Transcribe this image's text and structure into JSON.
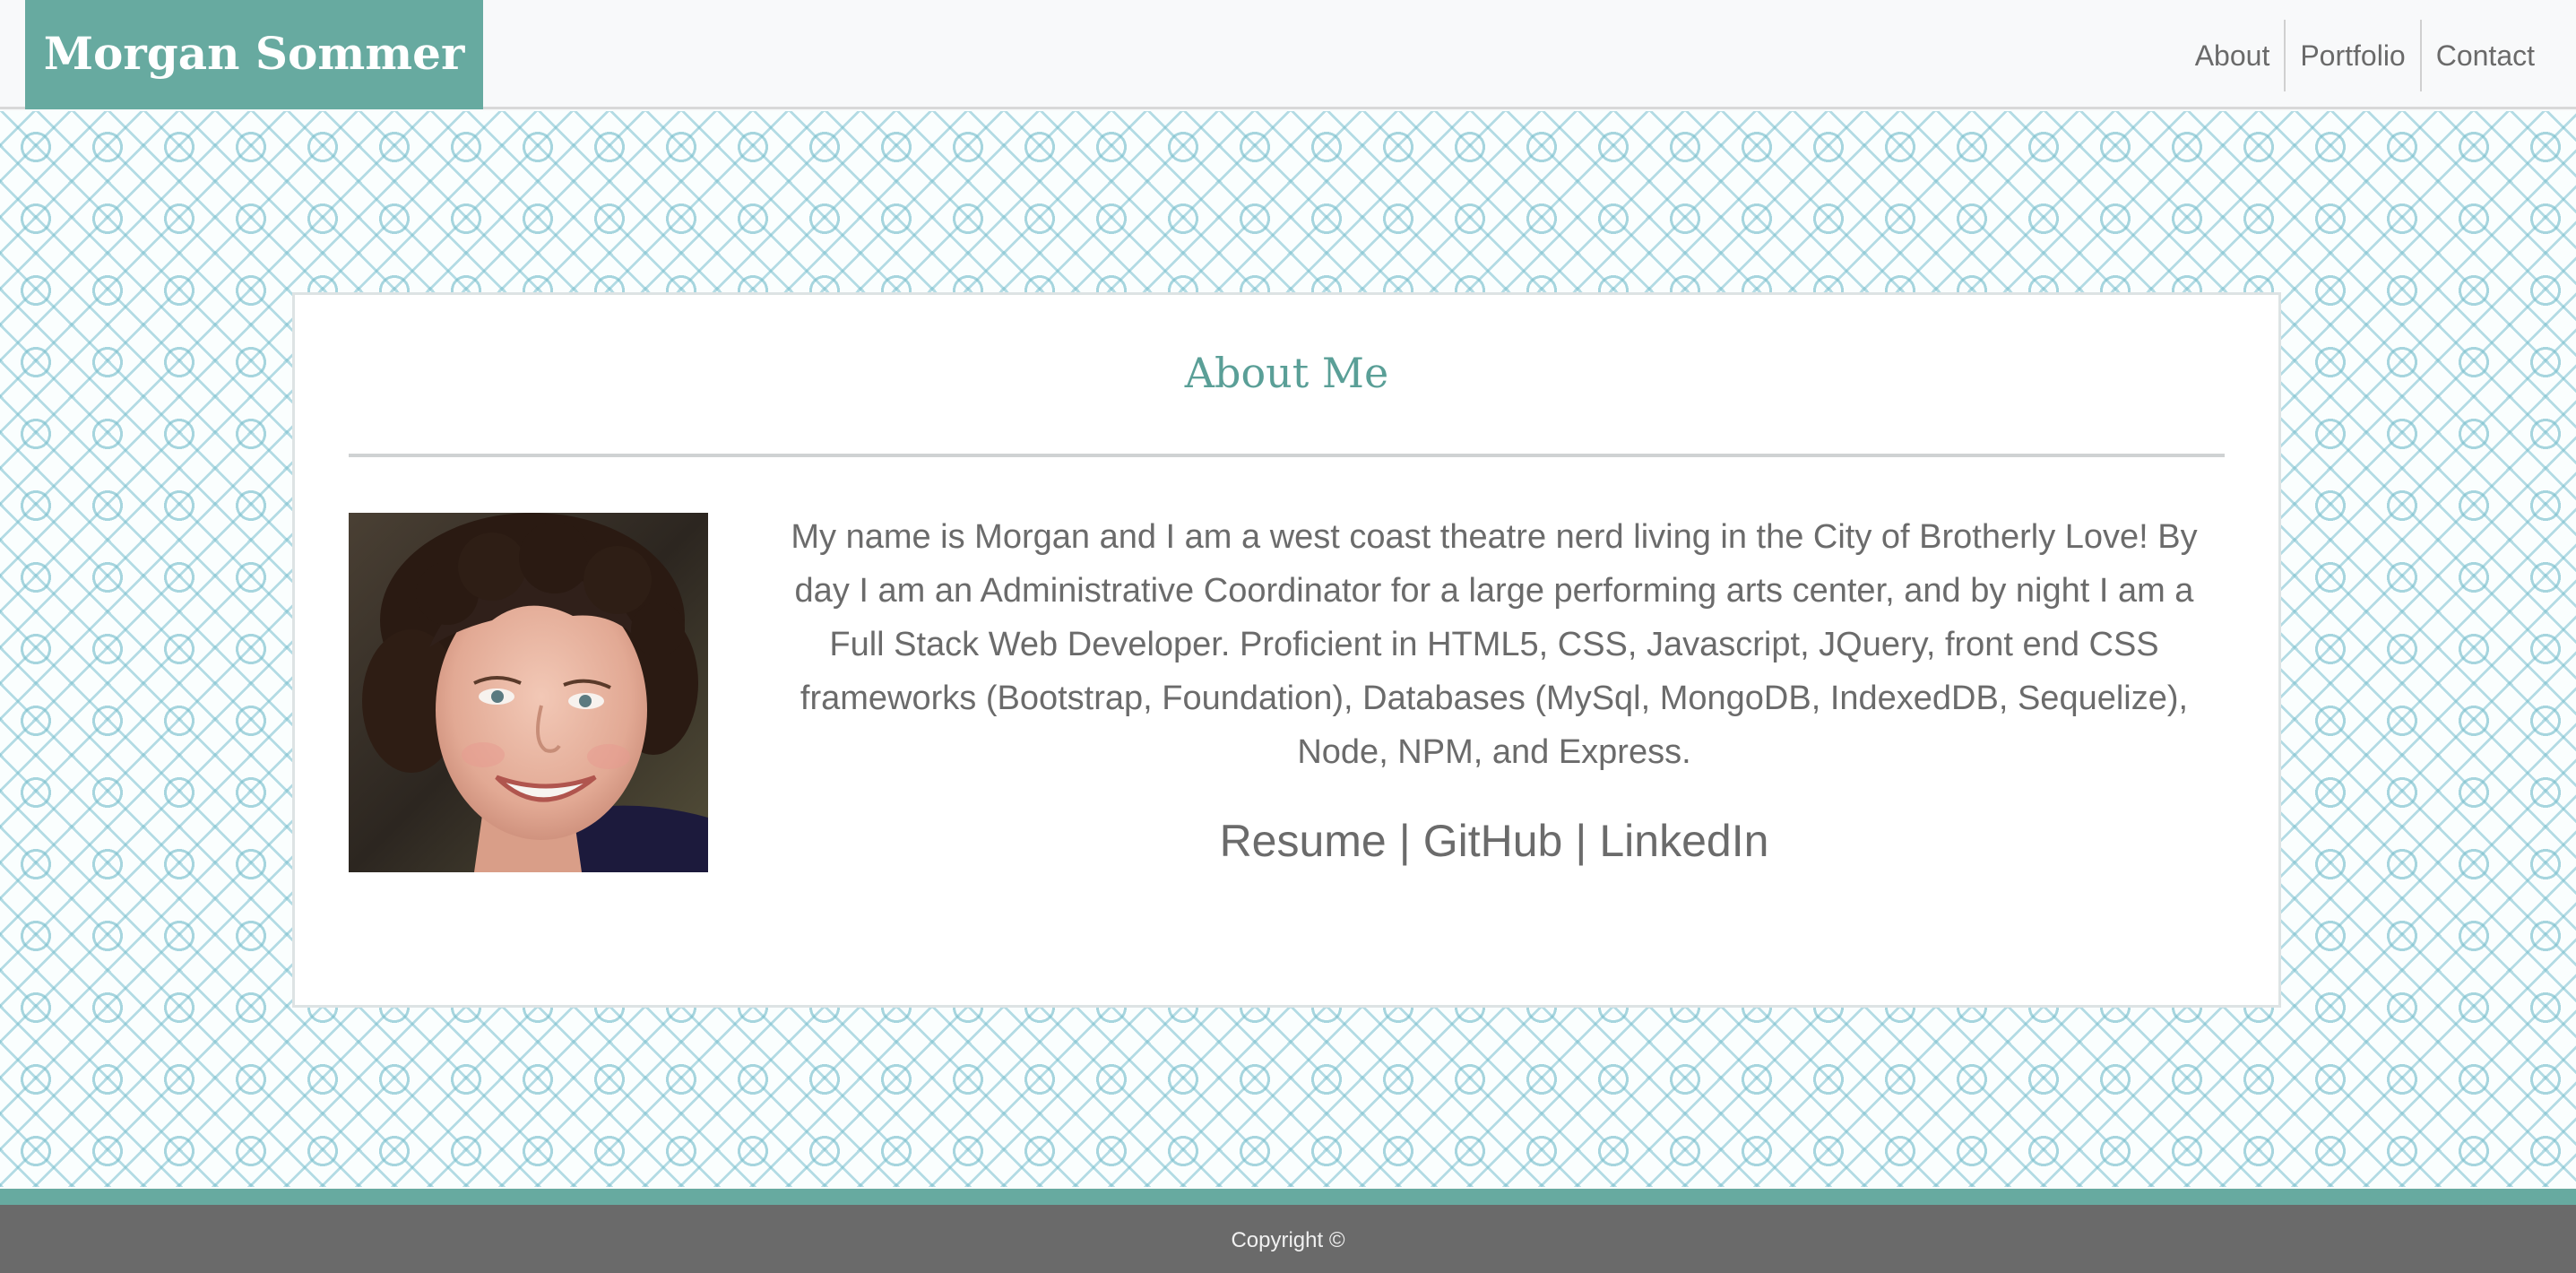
{
  "header": {
    "brand": "Morgan Sommer",
    "nav": [
      {
        "label": "About"
      },
      {
        "label": "Portfolio"
      },
      {
        "label": "Contact"
      }
    ]
  },
  "about": {
    "title": "About Me",
    "bio": "My name is Morgan and I am a west coast theatre nerd living in the City of Brotherly Love! By day I am an Administrative Coordinator for a large performing arts center, and by night I am a Full Stack Web Developer. Proficient in HTML5, CSS, Javascript, JQuery, front end CSS frameworks (Bootstrap, Foundation), Databases (MySql, MongoDB, IndexedDB, Sequelize), Node, NPM, and Express.",
    "links": {
      "resume": "Resume",
      "github": "GitHub",
      "linkedin": "LinkedIn",
      "separator": "|"
    }
  },
  "footer": {
    "copyright": "Copyright ©"
  },
  "colors": {
    "accent": "#67aaa0",
    "title": "#5a9f97",
    "text": "#6b6b6b",
    "footer_bg": "#6a6a6a"
  }
}
